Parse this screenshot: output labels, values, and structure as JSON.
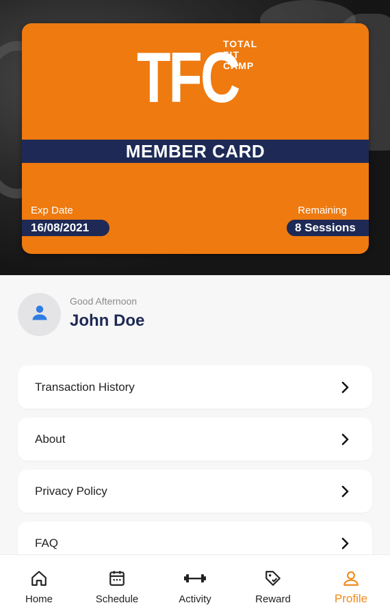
{
  "card": {
    "logo_letters": "TFC",
    "logo_words": [
      "TOTAL",
      "FIT",
      "CAMP"
    ],
    "title": "MEMBER CARD",
    "exp_label": "Exp Date",
    "exp_value": "16/08/2021",
    "remaining_label": "Remaining",
    "remaining_value": "8 Sessions",
    "colors": {
      "card": "#ee7a10",
      "band": "#1e2a55"
    }
  },
  "profile": {
    "greeting": "Good Afternoon",
    "name": "John Doe",
    "avatar_icon": "user-icon"
  },
  "menu": {
    "items": [
      {
        "label": "Transaction History",
        "icon": "chevron-right-icon"
      },
      {
        "label": "About",
        "icon": "chevron-right-icon"
      },
      {
        "label": "Privacy Policy",
        "icon": "chevron-right-icon"
      },
      {
        "label": "FAQ",
        "icon": "chevron-right-icon"
      }
    ]
  },
  "nav": {
    "items": [
      {
        "label": "Home",
        "icon": "home-icon"
      },
      {
        "label": "Schedule",
        "icon": "calendar-icon"
      },
      {
        "label": "Activity",
        "icon": "dumbbell-icon"
      },
      {
        "label": "Reward",
        "icon": "tag-icon"
      },
      {
        "label": "Profile",
        "icon": "user-icon",
        "active": true
      }
    ],
    "active_color": "#f28a1a"
  }
}
